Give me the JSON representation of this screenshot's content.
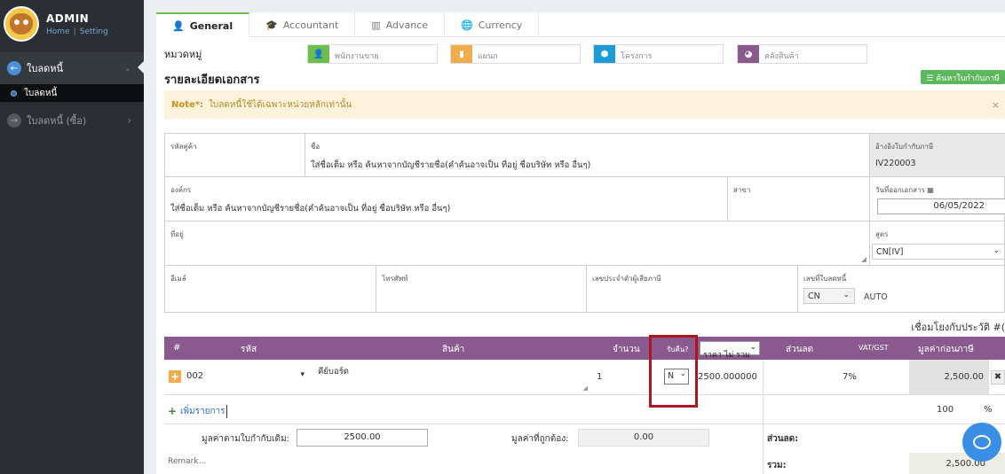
{
  "sidebar": {
    "brand_name": "ADMIN",
    "link_home": "Home",
    "link_setting": "Setting",
    "sep": "|",
    "group_label": "ใบลดหนี้",
    "sub_active": "ใบลดหนี้",
    "item2_label": "ใบลดหนี้ (ซื้อ)"
  },
  "tabs": [
    {
      "label": "General",
      "icon": "user-icon"
    },
    {
      "label": "Accountant",
      "icon": "graduation-cap-icon"
    },
    {
      "label": "Advance",
      "icon": "columns-icon"
    },
    {
      "label": "Currency",
      "icon": "globe-icon"
    }
  ],
  "category": {
    "label": "หมวดหมู่",
    "employee_placeholder": "พนักงานขาย",
    "department_placeholder": "แผนก",
    "project_placeholder": "โครงการ",
    "warehouse_placeholder": "คลังสินค้า",
    "colors": {
      "employee": "#6bbf4a",
      "department": "#f0ad4e",
      "project": "#1a9cd8",
      "warehouse": "#8a5a8f"
    }
  },
  "doc": {
    "section_title": "รายละเอียดเอกสาร",
    "search_tax_btn": "ค้นหาใบกำกับภาษี",
    "note_label": "Note*:",
    "note_text": "ใบลดหนี้ใช้ได้เฉพาะหน่วยหลักเท่านั้น",
    "note_close": "×"
  },
  "form": {
    "customer_code_label": "รหัสคู่ค้า",
    "name_label": "ชื่อ",
    "name_placeholder": "ใส่ชื่อเต็ม หรือ ค้นหาจากบัญชีรายชื่อ(คำค้นอาจเป็น ที่อยู่ ชื่อบริษัท หรือ อื่นๆ)",
    "tax_ref_label": "อ้างอิงใบกำกับภาษี",
    "tax_ref_value": "IV220003",
    "org_label": "องค์กร",
    "org_placeholder": "ใส่ชื่อเต็ม หรือ ค้นหาจากบัญชีรายชื่อ(คำค้นอาจเป็น ที่อยู่ ชื่อบริษัท หรือ อื่นๆ)",
    "branch_label": "สาขา",
    "doc_date_label": "วันที่ออกเอกสาร",
    "doc_date_value": "06/05/2022",
    "address_label": "ที่อยู่",
    "formula_label": "สูตร",
    "formula_value": "CN[IV]",
    "email_label": "อีเมล์",
    "phone_label": "โทรศัพท์",
    "taxid_label": "เลขประจำตัวผู้เสียภาษี",
    "cn_no_label": "เลขที่ใบลดหนี้",
    "cn_prefix_value": "CN",
    "cn_auto": "AUTO",
    "history_link": "เชื่อมโยงกับประวัติ #("
  },
  "table": {
    "headers": {
      "hash": "#",
      "code": "รหัส",
      "product": "สินค้า",
      "qty": "จำนวน",
      "returned": "รับคืน?",
      "price_mode": "ราคา ไม่ รวม",
      "discount": "ส่วนลด",
      "vat": "VAT/GST",
      "pretax": "มูลค่าก่อนภาษี"
    },
    "rows": [
      {
        "code": "002",
        "product": "คีย์บอร์ด",
        "qty": "1",
        "returned": "N",
        "price": "2500.000000",
        "vat": "7%",
        "pretax": "2,500.00"
      }
    ],
    "add_item": "เพิ่มรายการ",
    "percent_value": "100",
    "percent_sign": "%"
  },
  "totals": {
    "original_label": "มูลค่าตามใบกำกับเดิม:",
    "original_value": "2500.00",
    "correct_label": "มูลค่าที่ถูกต้อง:",
    "correct_value": "0.00",
    "discount_label": "ส่วนลด:",
    "remark_placeholder": "Remark...",
    "sum_label": "รวม:",
    "sum_value": "2,500.00"
  }
}
